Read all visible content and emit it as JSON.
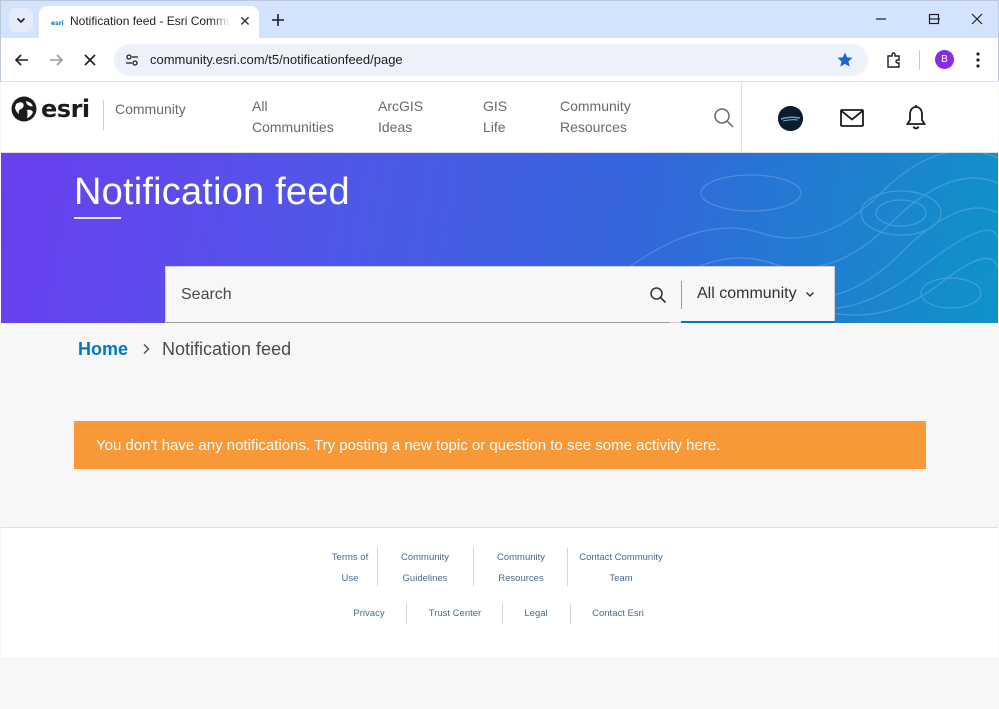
{
  "browser": {
    "tab_title": "Notification feed - Esri Community",
    "url": "community.esri.com/t5/notificationfeed/page",
    "profile_initial": "B"
  },
  "header": {
    "logo_text": "esri",
    "brand": "Community",
    "nav": [
      {
        "line1": "All",
        "line2": "Communities"
      },
      {
        "line1": "ArcGIS",
        "line2": "Ideas"
      },
      {
        "line1": "GIS",
        "line2": "Life"
      },
      {
        "line1": "Community",
        "line2": "Resources"
      }
    ]
  },
  "hero": {
    "title": "Notification feed"
  },
  "search": {
    "placeholder": "Search",
    "scope": "All community"
  },
  "breadcrumb": {
    "home": "Home",
    "current": "Notification feed"
  },
  "alert": {
    "message": "You don't have any notifications. Try posting a new topic or question to see some activity here."
  },
  "footer": {
    "row1": [
      {
        "line1": "Terms of",
        "line2": "Use"
      },
      {
        "line1": "Community",
        "line2": "Guidelines"
      },
      {
        "line1": "Community",
        "line2": "Resources"
      },
      {
        "line1": "Contact Community",
        "line2": "Team"
      }
    ],
    "row2": [
      "Privacy",
      "Trust Center",
      "Legal",
      "Contact Esri"
    ]
  },
  "colors": {
    "accent": "#0079c1",
    "alert": "#f89836",
    "hero_start": "#6a3ff0",
    "hero_end": "#0f93c9"
  }
}
